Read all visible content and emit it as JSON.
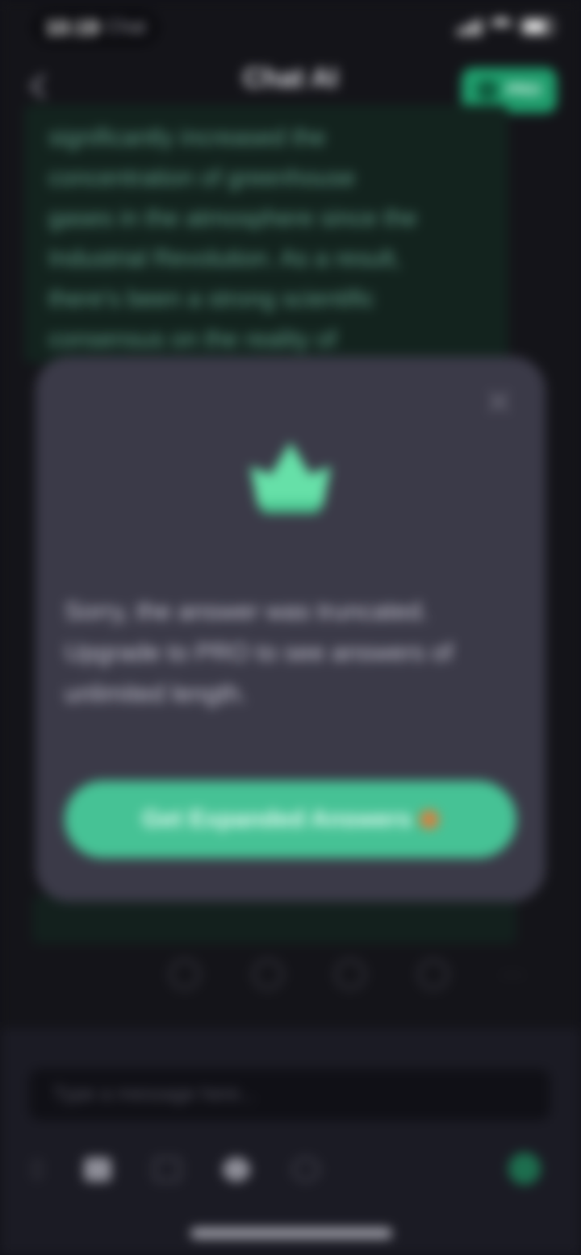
{
  "status_bar": {
    "time": "10:19",
    "sub": "Chat"
  },
  "header": {
    "title": "Chat AI",
    "subtitle": "",
    "upgrade_chip_label": "PRO"
  },
  "message": {
    "lines": [
      "significantly increased the",
      "concentration of greenhouse",
      "gases in the atmosphere since the",
      "Industrial Revolution. As a result,",
      "there's been a strong scientific",
      "consensus on the reality of"
    ]
  },
  "modal": {
    "close_label": "×",
    "icon": "crown-icon",
    "message": "Sorry, the answer was truncated. Upgrade to PRO to see answers of unlimited length.",
    "cta_label": "Get Expanded Answers",
    "cta_emoji": "fire-emoji"
  },
  "actions": {
    "icons": [
      "copy-icon",
      "share-icon",
      "regenerate-icon",
      "translate-icon"
    ],
    "more_label": "···"
  },
  "composer": {
    "placeholder": "Type a message here...",
    "toolbar_icons": [
      "grip-icon",
      "camera-icon",
      "document-icon",
      "image-icon",
      "voice-icon"
    ],
    "send_icon": "send-icon"
  },
  "colors": {
    "accent": "#46c295",
    "modal_bg": "#3b3a48",
    "screen_bg": "#141419"
  }
}
